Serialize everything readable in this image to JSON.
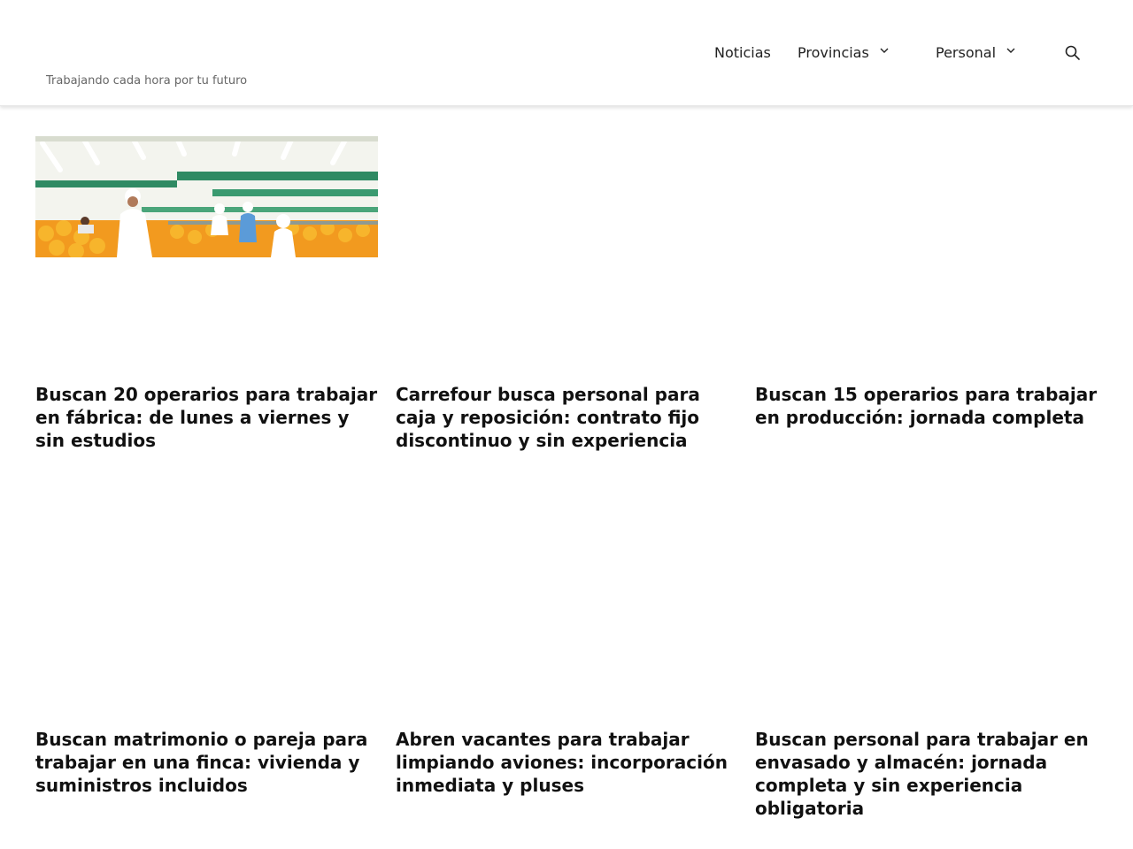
{
  "header": {
    "tagline": "Trabajando cada hora por tu futuro",
    "nav": [
      {
        "label": "Noticias"
      },
      {
        "label": "Provincias"
      },
      {
        "label": "Personal"
      }
    ]
  },
  "articles": [
    {
      "title": "Buscan 20 operarios para trabajar en fábrica: de lunes a viernes y sin estudios",
      "image": "oranges-factory-workers-photo"
    },
    {
      "title": "Carrefour busca personal para caja y reposición: contrato fijo discontinuo y sin experiencia"
    },
    {
      "title": "Buscan 15 operarios para trabajar en producción: jornada completa"
    },
    {
      "title": "Buscan matrimonio o pareja para trabajar en una finca: vivienda y suministros incluidos"
    },
    {
      "title": "Abren vacantes para trabajar limpiando aviones: incorporación inmediata y pluses"
    },
    {
      "title": "Buscan personal para trabajar en envasado y almacén: jornada completa y sin experiencia obligatoria"
    }
  ],
  "colors": {
    "text": "#111111",
    "tagline": "#666666",
    "background": "#ffffff"
  }
}
